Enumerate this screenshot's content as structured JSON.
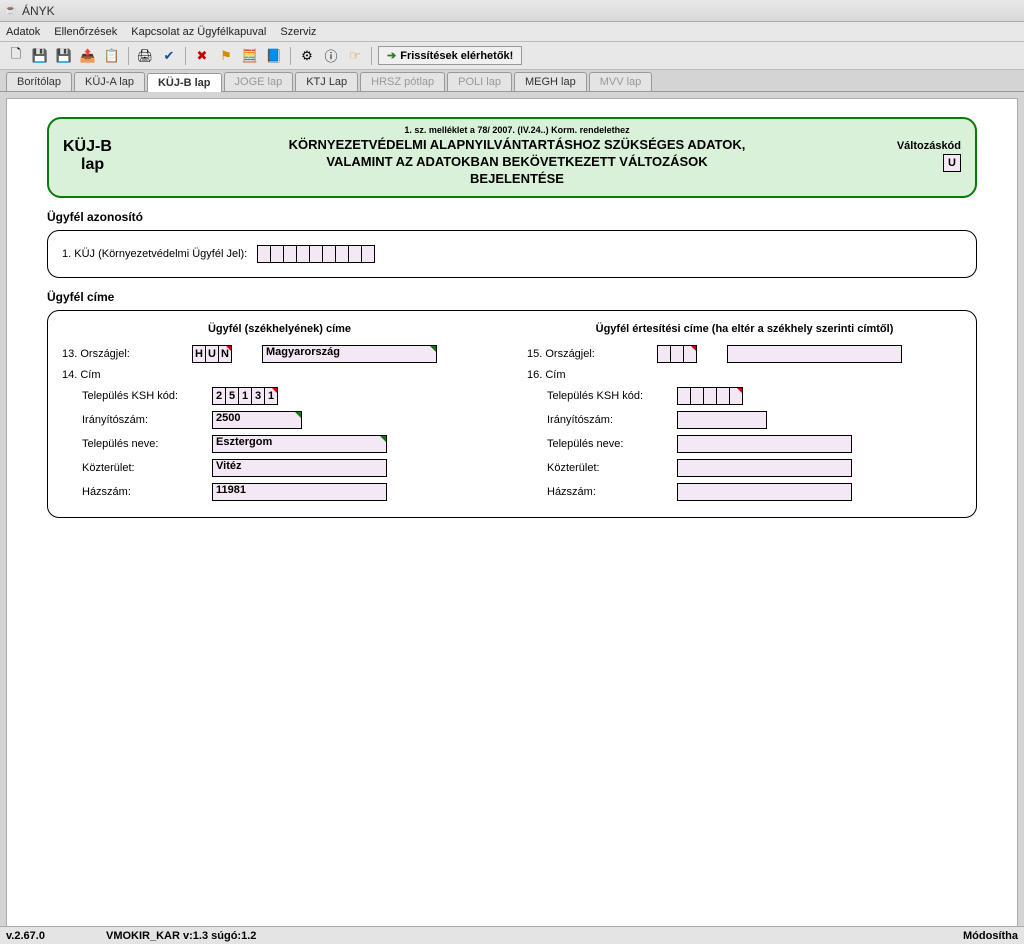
{
  "window": {
    "title": "ÁNYK"
  },
  "menu": {
    "adatok": "Adatok",
    "ellen": "Ellenőrzések",
    "kapcs": "Kapcsolat az Ügyfélkapuval",
    "szerviz": "Szerviz"
  },
  "refresh": "Frissítések elérhetők!",
  "tabs": {
    "borito": "Borítólap",
    "kuja": "KÜJ-A lap",
    "kujb": "KÜJ-B lap",
    "joge": "JOGE lap",
    "ktj": "KTJ Lap",
    "hrsz": "HRSZ pótlap",
    "poli": "POLI lap",
    "megh": "MEGH lap",
    "mvv": "MVV lap"
  },
  "header": {
    "left1": "KÜJ-B",
    "left2": "lap",
    "small": "1. sz. melléklet a 78/ 2007. (IV.24..) Korm. rendelethez",
    "t1": "KÖRNYEZETVÉDELMI ALAPNYILVÁNTARTÁSHOZ SZÜKSÉGES ADATOK,",
    "t2": "VALAMINT AZ ADATOKBAN BEKÖVETKEZETT VÁLTOZÁSOK",
    "t3": "BEJELENTÉSE",
    "rlabel": "Változáskód",
    "rcode": "U"
  },
  "sections": {
    "azon_title": "Ügyfél azonosító",
    "kuj_label": "1. KÜJ (Környezetvédelmi Ügyfél Jel):",
    "kuj_cells": [
      "",
      "",
      "",
      "",
      "",
      "",
      "",
      "",
      ""
    ],
    "cim_title": "Ügyfél címe",
    "colA_title": "Ügyfél (székhelyének) címe",
    "colB_title": "Ügyfél értesítési címe (ha eltér a székhely szerinti címtől)",
    "orszagjel": "13. Országjel:",
    "orszagjel2": "15. Országjel:",
    "ojA": [
      "H",
      "U",
      "N"
    ],
    "ojB": [
      "",
      "",
      ""
    ],
    "orszagA": "Magyarország",
    "orszagB": "",
    "cimA": "14. Cím",
    "cimB": "16. Cím",
    "ksh": "Település KSH kód:",
    "kshA": [
      "2",
      "5",
      "1",
      "3",
      "1"
    ],
    "kshB": [
      "",
      "",
      "",
      "",
      ""
    ],
    "irsz": "Irányítószám:",
    "irszA": "2500",
    "irszB": "",
    "telep": "Település neve:",
    "telepA": "Esztergom",
    "telepB": "",
    "kozt": "Közterület:",
    "koztA": "Vitéz",
    "koztB": "",
    "hsz": "Házszám:",
    "hszA": "11981",
    "hszB": ""
  },
  "status": {
    "ver": "v.2.67.0",
    "doc": "VMOKIR_KAR v:1.3 súgó:1.2",
    "mode": "Módosítha"
  }
}
